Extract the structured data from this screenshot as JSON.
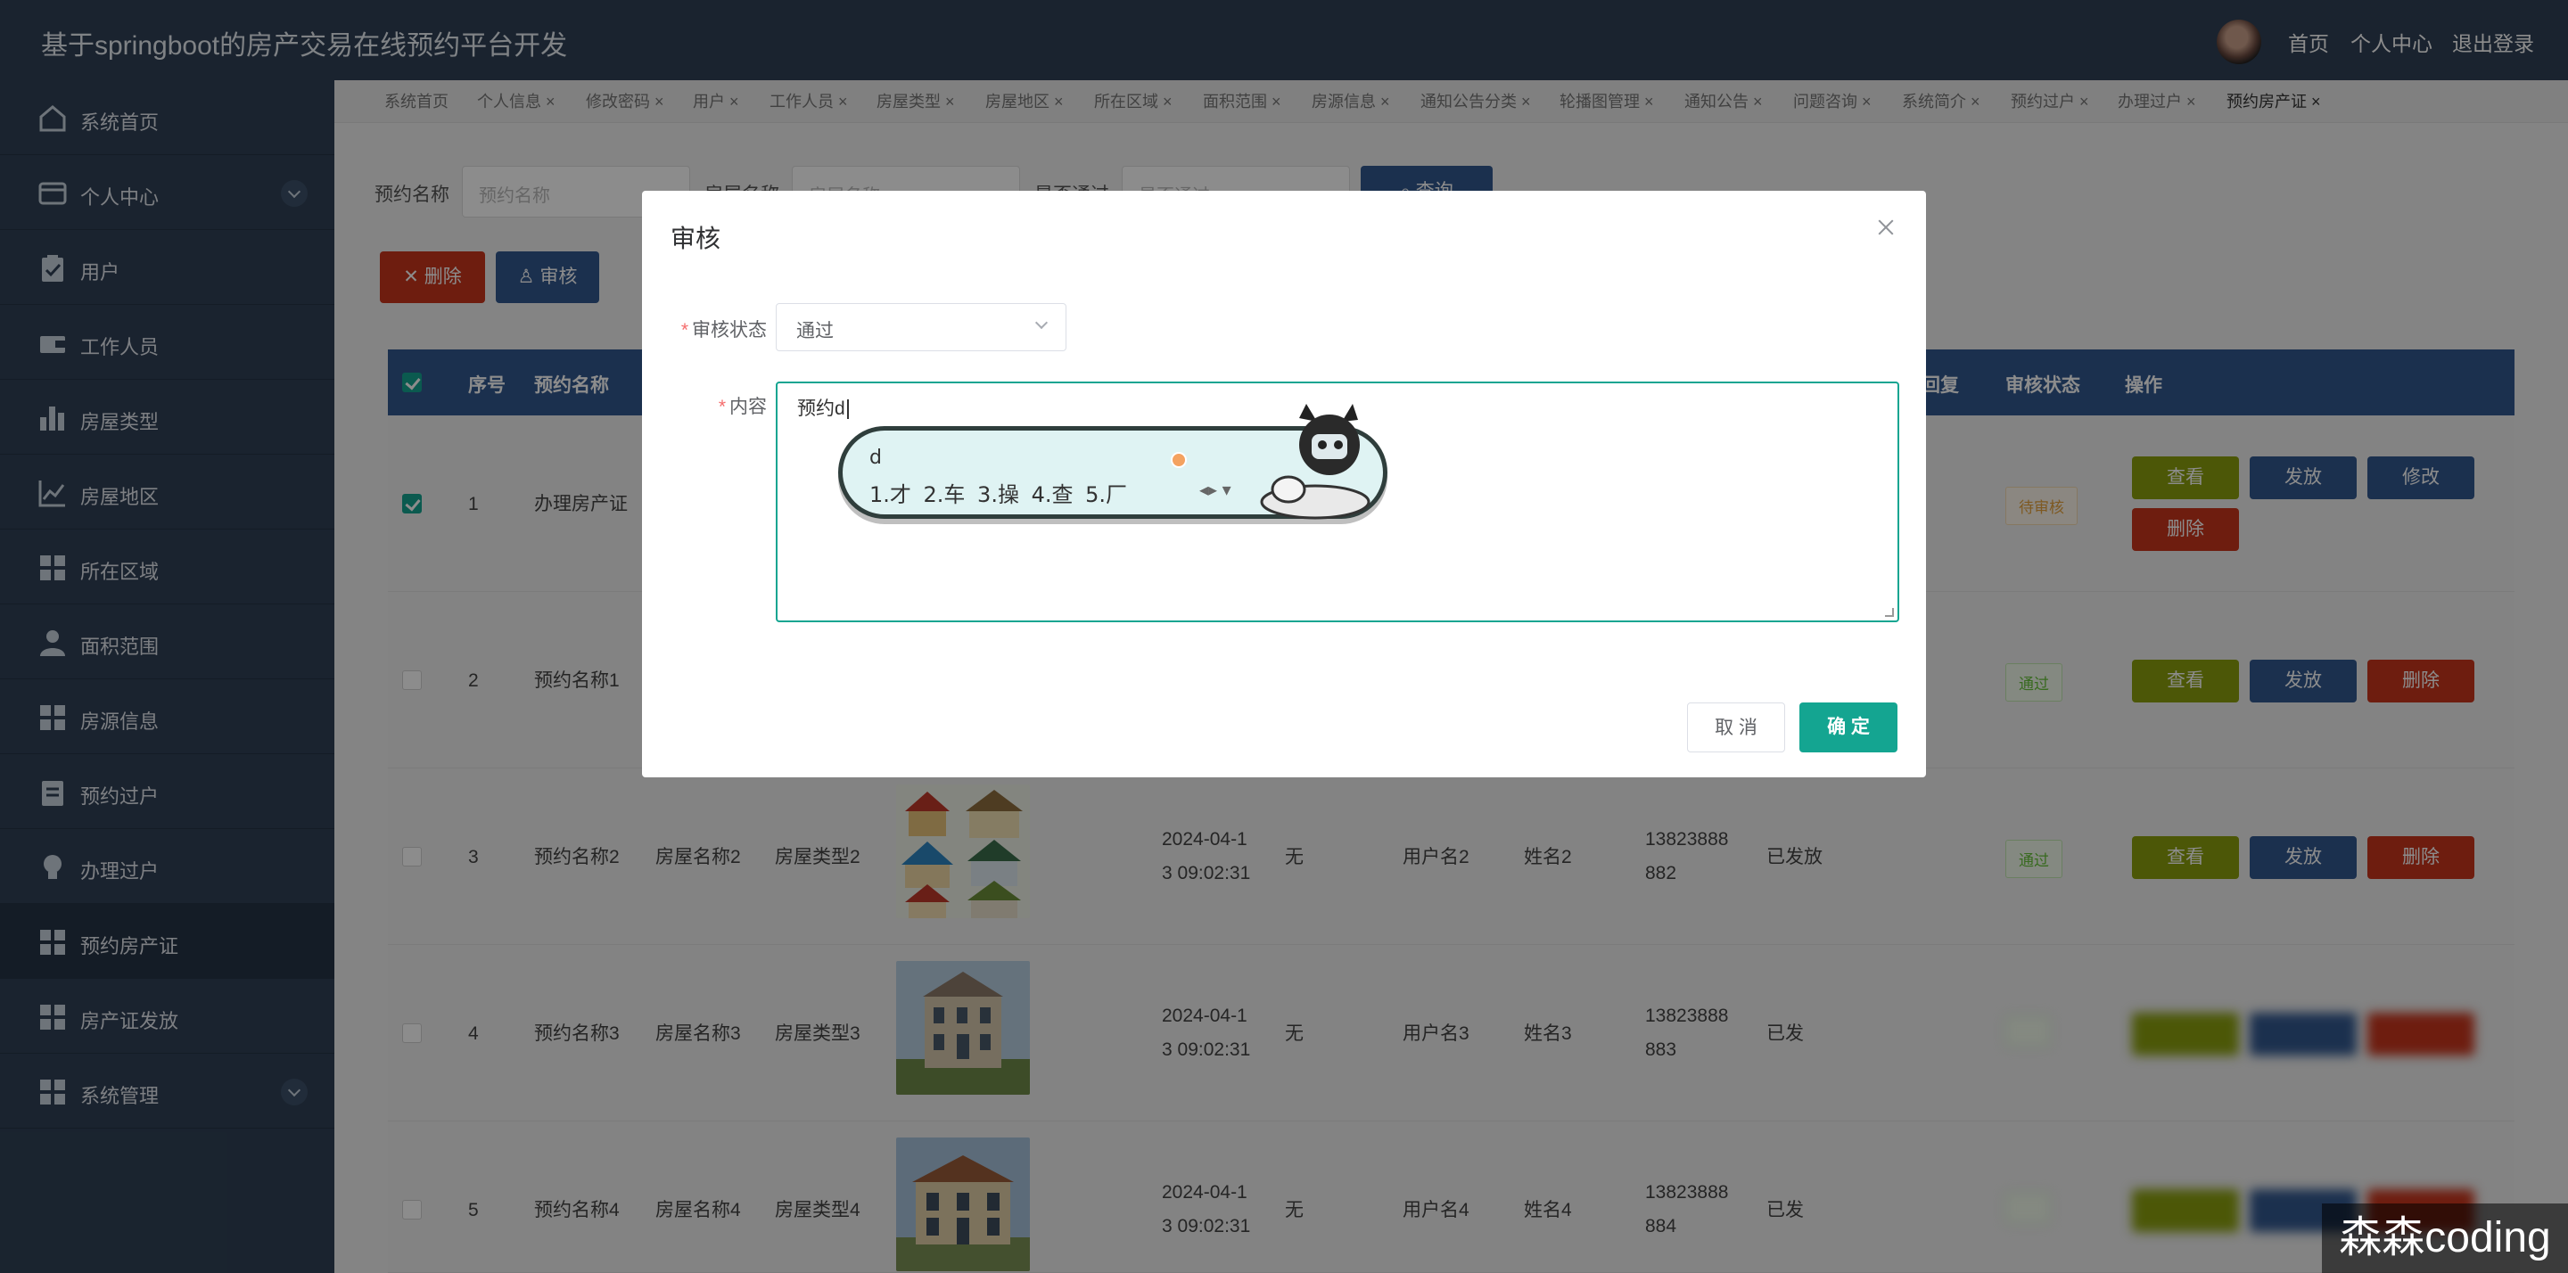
{
  "app": {
    "title": "基于springboot的房产交易在线预约平台开发",
    "header_links": [
      "首页",
      "个人中心",
      "退出登录"
    ]
  },
  "sidebar": {
    "items": [
      {
        "label": "系统首页",
        "icon": "home-icon"
      },
      {
        "label": "个人中心",
        "icon": "wallet-icon",
        "expandable": true
      },
      {
        "label": "用户",
        "icon": "clipboard-check-icon"
      },
      {
        "label": "工作人员",
        "icon": "wallet-icon"
      },
      {
        "label": "房屋类型",
        "icon": "bar-chart-icon"
      },
      {
        "label": "房屋地区",
        "icon": "line-chart-icon"
      },
      {
        "label": "所在区域",
        "icon": "grid-icon"
      },
      {
        "label": "面积范围",
        "icon": "person-icon"
      },
      {
        "label": "房源信息",
        "icon": "grid-icon"
      },
      {
        "label": "预约过户",
        "icon": "document-icon"
      },
      {
        "label": "办理过户",
        "icon": "lightbulb-icon"
      },
      {
        "label": "预约房产证",
        "icon": "grid-icon",
        "active": true
      },
      {
        "label": "房产证发放",
        "icon": "grid-icon"
      },
      {
        "label": "系统管理",
        "icon": "grid-icon",
        "expandable": true
      }
    ]
  },
  "tags": [
    "系统首页",
    "个人信息",
    "修改密码",
    "用户",
    "工作人员",
    "房屋类型",
    "房屋地区",
    "所在区域",
    "面积范围",
    "房源信息",
    "通知公告分类",
    "轮播图管理",
    "通知公告",
    "问题咨询",
    "系统简介",
    "预约过户",
    "办理过户",
    "预约房产证"
  ],
  "search": {
    "fields": [
      {
        "label": "预约名称",
        "placeholder": "预约名称"
      },
      {
        "label": "房屋名称",
        "placeholder": "房屋名称"
      },
      {
        "label": "是否通过",
        "placeholder": "是否通过"
      }
    ],
    "query_label": "查询"
  },
  "toolbar": {
    "delete_label": "删除",
    "audit_label": "审核"
  },
  "table": {
    "headers": {
      "seq": "序号",
      "name": "预约名称",
      "reply": "回复",
      "status": "审核状态",
      "ops": "操作"
    },
    "rows": [
      {
        "seq": "1",
        "name": "办理房产证",
        "checked": true,
        "status": "待审核",
        "status_kind": "wait",
        "actions": [
          "查看",
          "发放",
          "修改",
          "删除"
        ]
      },
      {
        "seq": "2",
        "name": "预约名称1",
        "checked": false,
        "status": "通过",
        "status_kind": "pass",
        "actions": [
          "查看",
          "发放",
          "删除"
        ]
      },
      {
        "seq": "3",
        "name": "预约名称2",
        "house": "房屋名称2",
        "type": "房屋类型2",
        "time1": "2024-04-1",
        "time2": "3 09:02:31",
        "remark": "无",
        "user": "用户名2",
        "real": "姓名2",
        "phone1": "13823888",
        "phone2": "882",
        "issued": "已发放",
        "checked": false,
        "status": "通过",
        "status_kind": "pass",
        "actions": [
          "查看",
          "发放",
          "删除"
        ]
      },
      {
        "seq": "4",
        "name": "预约名称3",
        "house": "房屋名称3",
        "type": "房屋类型3",
        "time1": "2024-04-1",
        "time2": "3 09:02:31",
        "remark": "无",
        "user": "用户名3",
        "real": "姓名3",
        "phone1": "13823888",
        "phone2": "883",
        "issued": "已发",
        "checked": false,
        "status": "",
        "status_kind": "pass",
        "actions": [
          "",
          "",
          ""
        ]
      },
      {
        "seq": "5",
        "name": "预约名称4",
        "house": "房屋名称4",
        "type": "房屋类型4",
        "time1": "2024-04-1",
        "time2": "3 09:02:31",
        "remark": "无",
        "user": "用户名4",
        "real": "姓名4",
        "phone1": "13823888",
        "phone2": "884",
        "issued": "已发",
        "checked": false,
        "status": "",
        "status_kind": "pass",
        "actions": [
          "",
          "",
          ""
        ]
      }
    ]
  },
  "dialog": {
    "title": "审核",
    "status_label": "审核状态",
    "status_value": "通过",
    "content_label": "内容",
    "content_value": "预约d",
    "cancel_label": "取 消",
    "ok_label": "确 定"
  },
  "ime": {
    "composition": "d",
    "candidates": "1.才  2.车  3.操  4.查  5.厂"
  },
  "watermark": "森森coding",
  "colors": {
    "sidebar": "#304156",
    "accent": "#14a591",
    "primary": "#32588f",
    "danger": "#c8351c",
    "olive": "#8a9f0e"
  }
}
